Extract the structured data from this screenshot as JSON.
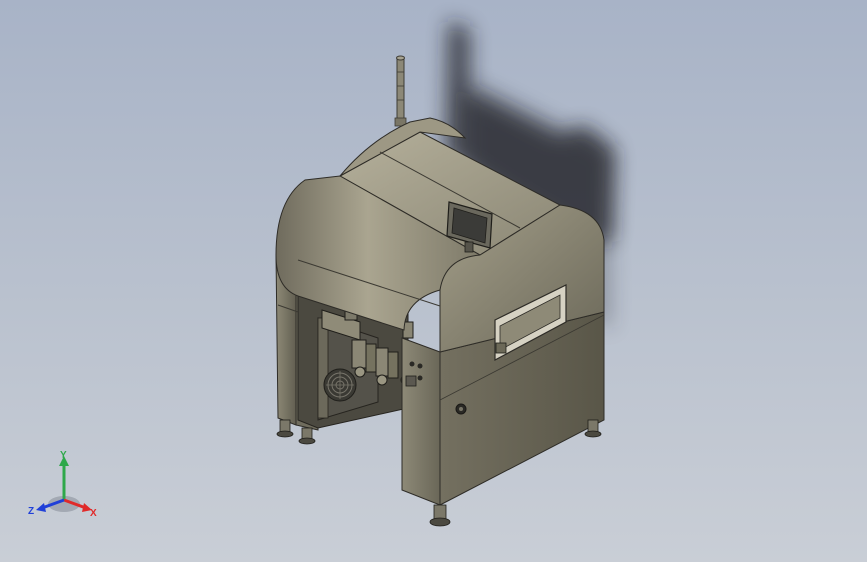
{
  "viewport": {
    "background_top": "#a8b3c7",
    "background_bottom": "#c9ced6",
    "model_color": "#8f8b78",
    "model_dark": "#555248",
    "shadow_color": "#1a1c22"
  },
  "triad": {
    "x_label": "X",
    "y_label": "Y",
    "z_label": "Z",
    "x_color": "#e02a2a",
    "y_color": "#2ea84a",
    "z_color": "#2040d8"
  }
}
